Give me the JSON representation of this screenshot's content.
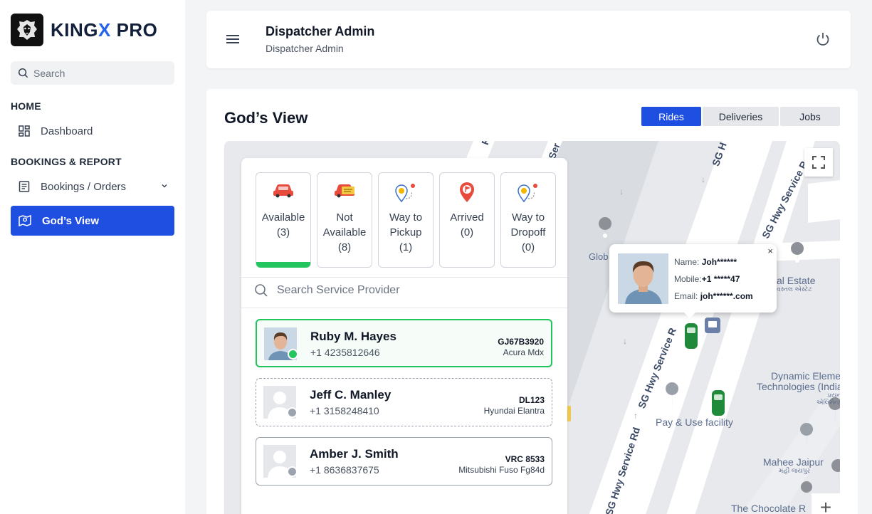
{
  "brand": {
    "name_prefix": "KING",
    "name_x": "X",
    "name_suffix": " PRO"
  },
  "sidebar": {
    "search_placeholder": "Search",
    "sections": [
      "HOME",
      "BOOKINGS & REPORT"
    ],
    "items": [
      {
        "label": "Dashboard",
        "icon": "dashboard-icon"
      },
      {
        "label": "Bookings / Orders",
        "icon": "list-icon"
      },
      {
        "label": "God’s View",
        "icon": "map-pin-icon",
        "active": true
      }
    ]
  },
  "header": {
    "title": "Dispatcher Admin",
    "subtitle": "Dispatcher Admin"
  },
  "main": {
    "title": "God’s View",
    "tabs": [
      {
        "label": "Rides",
        "active": true
      },
      {
        "label": "Deliveries"
      },
      {
        "label": "Jobs"
      }
    ]
  },
  "statuses": [
    {
      "line1": "Available",
      "line2": "(3)",
      "line3": "",
      "selected": true
    },
    {
      "line1": "Not",
      "line2": "Available",
      "line3": "(8)"
    },
    {
      "line1": "Way to",
      "line2": "Pickup",
      "line3": "(1)"
    },
    {
      "line1": "Arrived",
      "line2": "(0)",
      "line3": ""
    },
    {
      "line1": "Way to",
      "line2": "Dropoff",
      "line3": "(0)"
    }
  ],
  "provider_search_placeholder": "Search Service Provider",
  "drivers": [
    {
      "name": "Ruby M. Hayes",
      "phone": "+1 4235812646",
      "plate": "GJ67B3920",
      "model": "Acura Mdx",
      "online": true
    },
    {
      "name": "Jeff C. Manley",
      "phone": "+1 3158248410",
      "plate": "DL123",
      "model": "Hyundai Elantra",
      "online": false
    },
    {
      "name": "Amber J. Smith",
      "phone": "+1 8636837675",
      "plate": "VRC 8533",
      "model": "Mitsubishi Fuso Fg84d",
      "online": false
    }
  ],
  "popup": {
    "name_label": "Name:",
    "name_value": "Joh******",
    "mobile_label": "Mobile:",
    "mobile_value": "+1 *****47",
    "email_label": "Email:",
    "email_value": "joh******.com",
    "close": "×"
  },
  "map": {
    "labels": {
      "globe": "Glob",
      "estate": "al Estate",
      "estate_local": "વસ્તલ એસ્ટેટ",
      "dynamic1": "Dynamic Eleme",
      "dynamic2": "Technologies (India",
      "dynamic3": "ડાયન",
      "dynamic4": "એલિમેન્ટ",
      "payuse": "Pay & Use facility",
      "mahee": "Mahee Jaipur",
      "mahee_local": "મહી જયપુર",
      "choco": "The Chocolate R"
    },
    "roads": [
      "Rd",
      "Ser",
      "SG H",
      "SG Hwy Service Ro",
      "SG Hwy Service R",
      "SG Hwy Service Rd"
    ],
    "zoom_in": "+"
  },
  "colors": {
    "accent": "#1f4fe0",
    "available": "#22c55e"
  }
}
